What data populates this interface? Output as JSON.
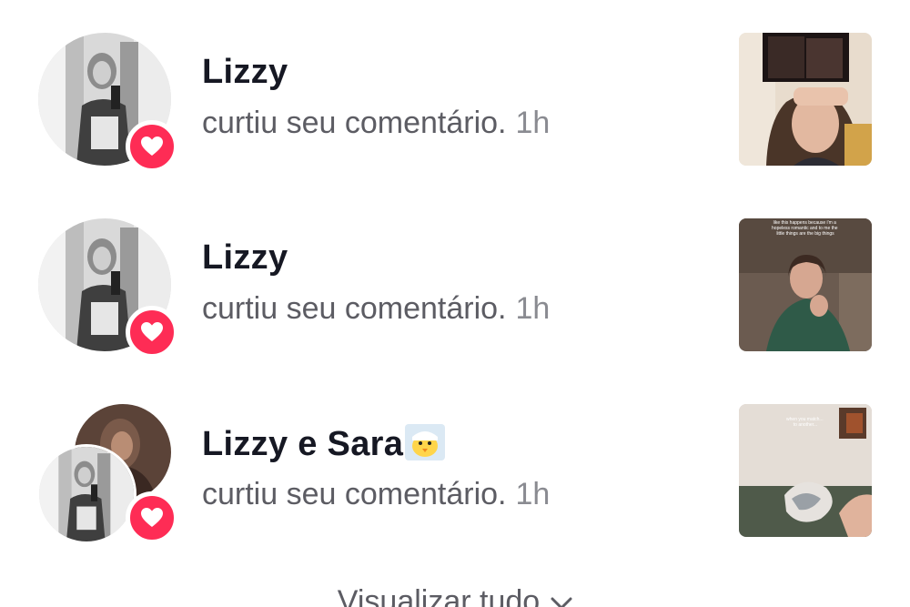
{
  "notifications": [
    {
      "name": "Lizzy",
      "action": "curtiu seu comentário.",
      "time": "1h",
      "thumbnail_caption": ""
    },
    {
      "name": "Lizzy",
      "action": "curtiu seu comentário.",
      "time": "1h",
      "thumbnail_caption": "like this happens because i'm a hopeless romantic and to me the little things are the big things"
    },
    {
      "name": "Lizzy e Sara",
      "action": "curtiu seu comentário.",
      "time": "1h",
      "thumbnail_caption": "when you match... to another..."
    }
  ],
  "footer": {
    "view_all_label": "Visualizar tudo"
  },
  "colors": {
    "heart_badge": "#fe2c55",
    "name_text": "#161823",
    "secondary_text": "#5c5c63"
  }
}
